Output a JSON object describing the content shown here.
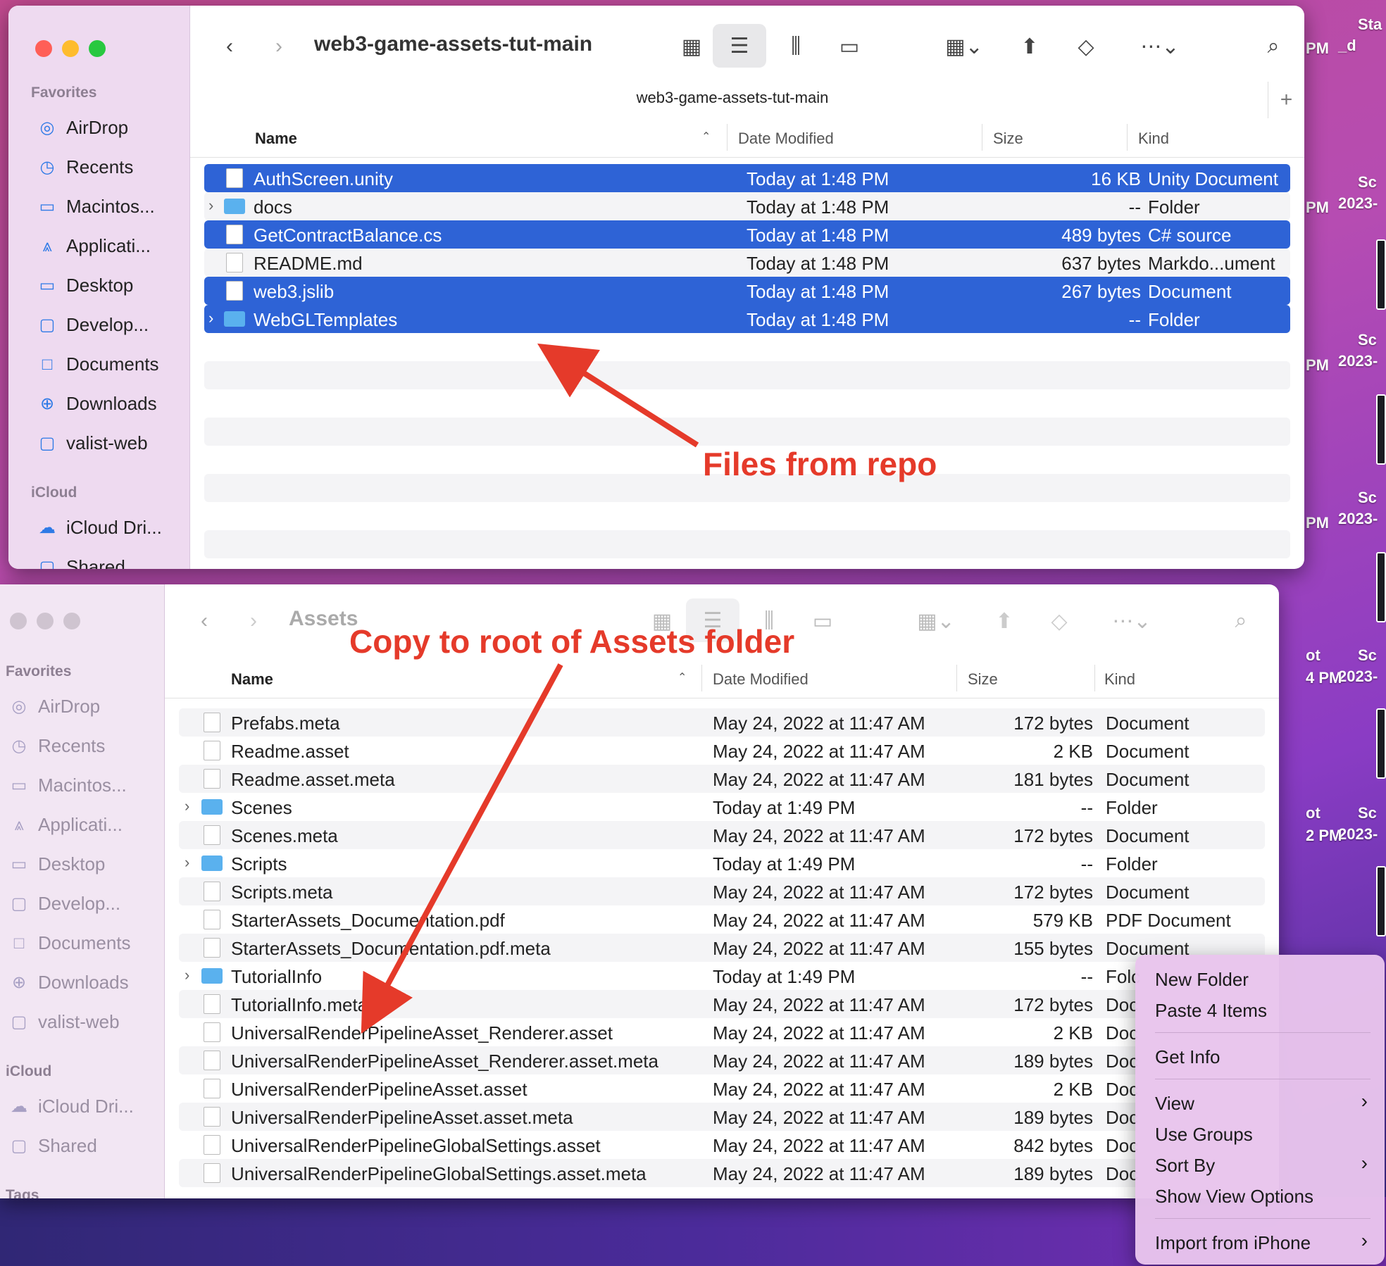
{
  "desktop": {
    "right_labels": [
      "Sta",
      "_d",
      "Sc",
      "2023-",
      "Sc",
      "2023-",
      "Sc",
      "2023-",
      "Sc",
      "2023-",
      "Sc",
      "2023-"
    ],
    "mid_labels": [
      "PM",
      "PM",
      "PM",
      "PM",
      "ot",
      "4 PM",
      "ot",
      "2 PM"
    ]
  },
  "top_window": {
    "title": "web3-game-assets-tut-main",
    "path": "web3-game-assets-tut-main",
    "sidebar": {
      "sections": [
        {
          "label": "Favorites"
        },
        {
          "label": "iCloud"
        }
      ],
      "items": [
        {
          "label": "AirDrop",
          "icon": "airdrop-icon"
        },
        {
          "label": "Recents",
          "icon": "clock-icon"
        },
        {
          "label": "Macintos...",
          "icon": "disk-icon"
        },
        {
          "label": "Applicati...",
          "icon": "apps-icon"
        },
        {
          "label": "Desktop",
          "icon": "desktop-icon"
        },
        {
          "label": "Develop...",
          "icon": "folder-icon"
        },
        {
          "label": "Documents",
          "icon": "document-icon"
        },
        {
          "label": "Downloads",
          "icon": "download-icon"
        },
        {
          "label": "valist-web",
          "icon": "folder-icon"
        },
        {
          "label": "iCloud Dri...",
          "icon": "cloud-icon"
        },
        {
          "label": "Shared",
          "icon": "shared-folder-icon"
        }
      ]
    },
    "columns": {
      "name": "Name",
      "date": "Date Modified",
      "size": "Size",
      "kind": "Kind"
    },
    "rows": [
      {
        "name": "AuthScreen.unity",
        "date": "Today at 1:48 PM",
        "size": "16 KB",
        "kind": "Unity Document",
        "selected": true,
        "type": "unity"
      },
      {
        "name": "docs",
        "date": "Today at 1:48 PM",
        "size": "--",
        "kind": "Folder",
        "selected": false,
        "type": "folder"
      },
      {
        "name": "GetContractBalance.cs",
        "date": "Today at 1:48 PM",
        "size": "489 bytes",
        "kind": "C# source",
        "selected": true,
        "type": "cs"
      },
      {
        "name": "README.md",
        "date": "Today at 1:48 PM",
        "size": "637 bytes",
        "kind": "Markdo...ument",
        "selected": false,
        "type": "file"
      },
      {
        "name": "web3.jslib",
        "date": "Today at 1:48 PM",
        "size": "267 bytes",
        "kind": "Document",
        "selected": true,
        "type": "file"
      },
      {
        "name": "WebGLTemplates",
        "date": "Today at 1:48 PM",
        "size": "--",
        "kind": "Folder",
        "selected": true,
        "type": "folder"
      }
    ],
    "annotation": "Files from repo"
  },
  "bottom_window": {
    "title": "Assets",
    "sidebar": {
      "sections": [
        {
          "label": "Favorites"
        },
        {
          "label": "iCloud"
        },
        {
          "label": "Tags"
        }
      ],
      "items": [
        {
          "label": "AirDrop"
        },
        {
          "label": "Recents"
        },
        {
          "label": "Macintos..."
        },
        {
          "label": "Applicati..."
        },
        {
          "label": "Desktop"
        },
        {
          "label": "Develop..."
        },
        {
          "label": "Documents"
        },
        {
          "label": "Downloads"
        },
        {
          "label": "valist-web"
        },
        {
          "label": "iCloud Dri..."
        },
        {
          "label": "Shared"
        }
      ]
    },
    "columns": {
      "name": "Name",
      "date": "Date Modified",
      "size": "Size",
      "kind": "Kind"
    },
    "rows": [
      {
        "name": "Prefabs.meta",
        "date": "May 24, 2022 at 11:47 AM",
        "size": "172 bytes",
        "kind": "Document",
        "type": "file"
      },
      {
        "name": "Readme.asset",
        "date": "May 24, 2022 at 11:47 AM",
        "size": "2 KB",
        "kind": "Document",
        "type": "file"
      },
      {
        "name": "Readme.asset.meta",
        "date": "May 24, 2022 at 11:47 AM",
        "size": "181 bytes",
        "kind": "Document",
        "type": "file"
      },
      {
        "name": "Scenes",
        "date": "Today at 1:49 PM",
        "size": "--",
        "kind": "Folder",
        "type": "folder"
      },
      {
        "name": "Scenes.meta",
        "date": "May 24, 2022 at 11:47 AM",
        "size": "172 bytes",
        "kind": "Document",
        "type": "file"
      },
      {
        "name": "Scripts",
        "date": "Today at 1:49 PM",
        "size": "--",
        "kind": "Folder",
        "type": "folder"
      },
      {
        "name": "Scripts.meta",
        "date": "May 24, 2022 at 11:47 AM",
        "size": "172 bytes",
        "kind": "Document",
        "type": "file"
      },
      {
        "name": "StarterAssets_Documentation.pdf",
        "date": "May 24, 2022 at 11:47 AM",
        "size": "579 KB",
        "kind": "PDF Document",
        "type": "pdf"
      },
      {
        "name": "StarterAssets_Documentation.pdf.meta",
        "date": "May 24, 2022 at 11:47 AM",
        "size": "155 bytes",
        "kind": "Document",
        "type": "file"
      },
      {
        "name": "TutorialInfo",
        "date": "Today at 1:49 PM",
        "size": "--",
        "kind": "Folc",
        "type": "folder"
      },
      {
        "name": "TutorialInfo.meta",
        "date": "May 24, 2022 at 11:47 AM",
        "size": "172 bytes",
        "kind": "Doc",
        "type": "file"
      },
      {
        "name": "UniversalRenderPipelineAsset_Renderer.asset",
        "date": "May 24, 2022 at 11:47 AM",
        "size": "2 KB",
        "kind": "Doc",
        "type": "file"
      },
      {
        "name": "UniversalRenderPipelineAsset_Renderer.asset.meta",
        "date": "May 24, 2022 at 11:47 AM",
        "size": "189 bytes",
        "kind": "Doc",
        "type": "file"
      },
      {
        "name": "UniversalRenderPipelineAsset.asset",
        "date": "May 24, 2022 at 11:47 AM",
        "size": "2 KB",
        "kind": "Doc",
        "type": "file"
      },
      {
        "name": "UniversalRenderPipelineAsset.asset.meta",
        "date": "May 24, 2022 at 11:47 AM",
        "size": "189 bytes",
        "kind": "Doc",
        "type": "file"
      },
      {
        "name": "UniversalRenderPipelineGlobalSettings.asset",
        "date": "May 24, 2022 at 11:47 AM",
        "size": "842 bytes",
        "kind": "Doc",
        "type": "file"
      },
      {
        "name": "UniversalRenderPipelineGlobalSettings.asset.meta",
        "date": "May 24, 2022 at 11:47 AM",
        "size": "189 bytes",
        "kind": "Doc",
        "type": "file"
      }
    ],
    "annotation": "Copy to root of Assets folder"
  },
  "context_menu": {
    "items": [
      {
        "label": "New Folder",
        "submenu": false
      },
      {
        "label": "Paste 4 Items",
        "submenu": false
      },
      {
        "label": "Get Info",
        "submenu": false
      },
      {
        "label": "View",
        "submenu": true
      },
      {
        "label": "Use Groups",
        "submenu": false
      },
      {
        "label": "Sort By",
        "submenu": true
      },
      {
        "label": "Show View Options",
        "submenu": false
      },
      {
        "label": "Import from iPhone",
        "submenu": true
      }
    ]
  },
  "colors": {
    "selection": "#2e63d6",
    "annotation": "#e53a2a",
    "folder": "#5ab1ee",
    "close": "#ff5f57",
    "minimize": "#febc2e",
    "zoom": "#28c840"
  }
}
